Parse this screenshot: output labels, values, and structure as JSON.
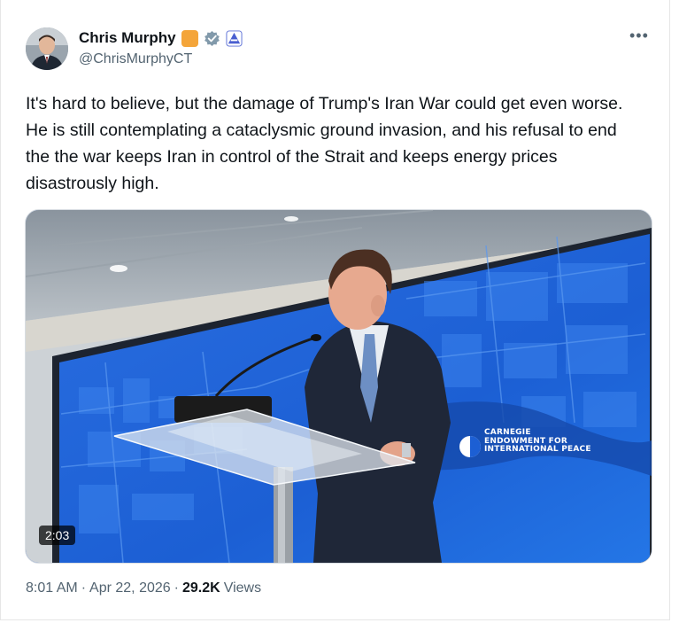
{
  "author": {
    "name": "Chris Murphy",
    "handle": "@ChrisMurphyCT"
  },
  "post": {
    "text": "It's hard to believe, but the damage of Trump's Iran War could get even worse. He is still contemplating a cataclysmic ground invasion, and his refusal to end the the war keeps Iran in control of the Strait and keeps energy prices disastrously high."
  },
  "media": {
    "duration": "2:03",
    "screen_logo": {
      "line1": "CARNEGIE",
      "line2": "ENDOWMENT FOR",
      "line3": "INTERNATIONAL PEACE"
    }
  },
  "meta": {
    "time": "8:01 AM",
    "separator": "·",
    "date": "Apr 22, 2026",
    "views_count": "29.2K",
    "views_label": "Views"
  },
  "icons": {
    "more": "more-icon",
    "gold_badge": "gold-badge-icon",
    "verified": "verified-icon",
    "government": "government-badge-icon"
  },
  "colors": {
    "text": "#0f1419",
    "secondary": "#536471",
    "gold_badge": "#f4a53a",
    "screen_blue": "#1a56c8"
  }
}
